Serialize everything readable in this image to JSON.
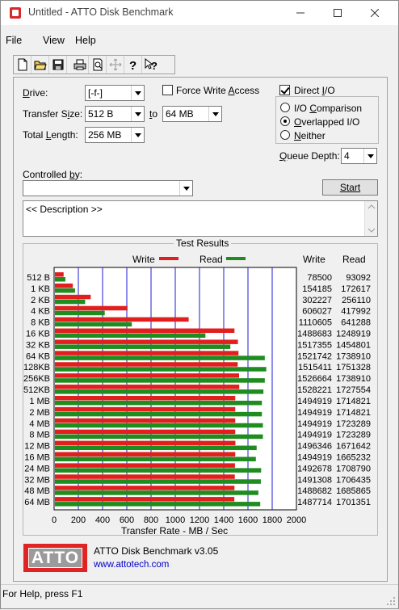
{
  "window": {
    "title": "Untitled - ATTO Disk Benchmark"
  },
  "menu": [
    "File",
    "View",
    "Help"
  ],
  "toolbar": {
    "icons": [
      "new-icon",
      "open-icon",
      "save-icon",
      "print-icon",
      "print-preview-icon",
      "move-icon",
      "help-icon",
      "context-help-icon"
    ]
  },
  "settings": {
    "drive_label": "Drive:",
    "drive_value": "[-f-]",
    "force_write_label": "Force Write Access",
    "force_write_checked": false,
    "direct_io_label": "Direct I/O",
    "direct_io_checked": true,
    "transfer_size_label": "Transfer Size:",
    "transfer_from": "512 B",
    "to_label": "to",
    "transfer_to": "64 MB",
    "total_length_label": "Total Length:",
    "total_length": "256 MB",
    "io_options": [
      {
        "label": "I/O Comparison",
        "selected": false
      },
      {
        "label": "Overlapped I/O",
        "selected": true
      },
      {
        "label": "Neither",
        "selected": false
      }
    ],
    "queue_depth_label": "Queue Depth:",
    "queue_depth": "4",
    "controlled_by_label": "Controlled by:",
    "controlled_by": "",
    "start_label": "Start",
    "description": "<< Description >>"
  },
  "results": {
    "title": "Test Results",
    "legend_write": "Write",
    "legend_read": "Read",
    "col_write": "Write",
    "col_read": "Read",
    "xlabel": "Transfer Rate - MB / Sec"
  },
  "chart_data": {
    "type": "bar",
    "orientation": "horizontal",
    "title": "Test Results",
    "xlabel": "Transfer Rate - MB / Sec",
    "xlim": [
      0,
      2000
    ],
    "xticks": [
      0,
      200,
      400,
      600,
      800,
      1000,
      1200,
      1400,
      1600,
      1800,
      2000
    ],
    "categories": [
      "512 B",
      "1 KB",
      "2 KB",
      "4 KB",
      "8 KB",
      "16 KB",
      "32 KB",
      "64 KB",
      "128KB",
      "256KB",
      "512KB",
      "1 MB",
      "2 MB",
      "4 MB",
      "8 MB",
      "12 MB",
      "16 MB",
      "24 MB",
      "32 MB",
      "48 MB",
      "64 MB"
    ],
    "series": [
      {
        "name": "Write",
        "color": "#e21f1f",
        "values": [
          78500,
          154185,
          302227,
          606027,
          1110605,
          1488683,
          1517355,
          1521742,
          1515411,
          1526664,
          1528221,
          1494919,
          1494919,
          1494919,
          1494919,
          1496346,
          1494919,
          1492678,
          1491308,
          1488682,
          1487714
        ]
      },
      {
        "name": "Read",
        "color": "#1f8c1f",
        "values": [
          93092,
          172617,
          256110,
          417992,
          641288,
          1248919,
          1454801,
          1738910,
          1751328,
          1738910,
          1727554,
          1714821,
          1714821,
          1723289,
          1723289,
          1671642,
          1665232,
          1708790,
          1706435,
          1685865,
          1701351
        ]
      }
    ],
    "grid_color": "#1c1cd4"
  },
  "footer": {
    "logo": "ATTO",
    "product": "ATTO Disk Benchmark v3.05",
    "url": "www.attotech.com"
  },
  "status": "For Help, press F1"
}
